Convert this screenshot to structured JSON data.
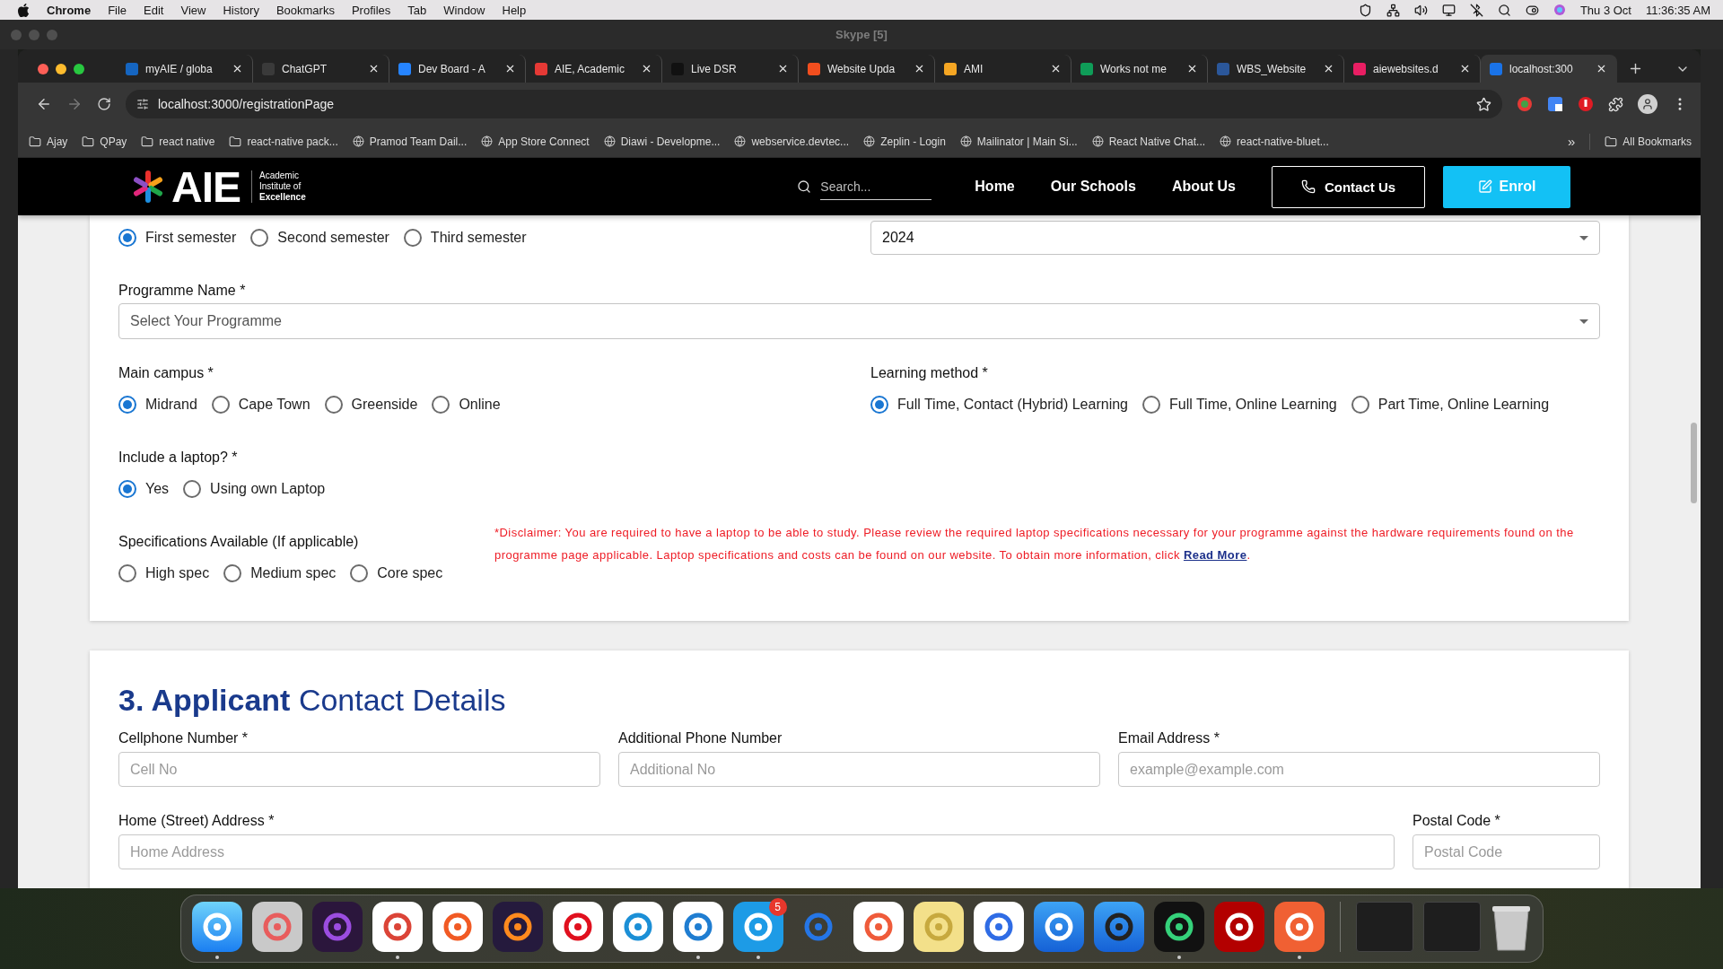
{
  "menu_bar": {
    "app": "Chrome",
    "items": [
      "File",
      "Edit",
      "View",
      "History",
      "Bookmarks",
      "Profiles",
      "Tab",
      "Window",
      "Help"
    ],
    "date": "Thu 3 Oct",
    "time": "11:36:35 AM"
  },
  "background_window": {
    "title": "Skype [5]"
  },
  "browser": {
    "tabs": [
      {
        "title": "myAIE / globa",
        "selected": false
      },
      {
        "title": "ChatGPT",
        "selected": false
      },
      {
        "title": "Dev Board - A",
        "selected": false
      },
      {
        "title": "AIE, Academic",
        "selected": false
      },
      {
        "title": "Live DSR",
        "selected": false
      },
      {
        "title": "Website Upda",
        "selected": false
      },
      {
        "title": "AMI",
        "selected": false
      },
      {
        "title": "Works not me",
        "selected": false
      },
      {
        "title": "WBS_Website",
        "selected": false
      },
      {
        "title": "aiewebsites.d",
        "selected": false
      },
      {
        "title": "localhost:300",
        "selected": true
      }
    ],
    "url": "localhost:3000/registrationPage",
    "bookmarks": [
      {
        "label": "Ajay",
        "kind": "folder"
      },
      {
        "label": "QPay",
        "kind": "folder"
      },
      {
        "label": "react native",
        "kind": "folder"
      },
      {
        "label": "react-native pack...",
        "kind": "folder"
      },
      {
        "label": "Pramod Team Dail...",
        "kind": "link"
      },
      {
        "label": "App Store Connect",
        "kind": "link"
      },
      {
        "label": "Diawi - Developme...",
        "kind": "link"
      },
      {
        "label": "webservice.devtec...",
        "kind": "link"
      },
      {
        "label": "Zeplin - Login",
        "kind": "link"
      },
      {
        "label": "Mailinator | Main Si...",
        "kind": "link"
      },
      {
        "label": "React Native Chat...",
        "kind": "link"
      },
      {
        "label": "react-native-bluet...",
        "kind": "link"
      }
    ],
    "more": "»",
    "all_bookmarks": "All Bookmarks"
  },
  "site": {
    "logo": {
      "name": "AIE",
      "tagline": [
        {
          "text": "Academic",
          "bold": false
        },
        {
          "text": "Institute of",
          "bold": false
        },
        {
          "text": "Excellence",
          "bold": true
        }
      ]
    },
    "search": {
      "placeholder": "Search..."
    },
    "nav": [
      "Home",
      "Our Schools",
      "About Us"
    ],
    "contact_button": "Contact Us",
    "enrol_button": "Enrol"
  },
  "form": {
    "semester": {
      "options": [
        {
          "label": "First semester",
          "selected": true
        },
        {
          "label": "Second semester",
          "selected": false
        },
        {
          "label": "Third semester",
          "selected": false
        }
      ]
    },
    "year": {
      "value": "2024"
    },
    "programme": {
      "label": "Programme Name *",
      "placeholder": "Select Your Programme"
    },
    "campus": {
      "label": "Main campus *",
      "options": [
        {
          "label": "Midrand",
          "selected": true
        },
        {
          "label": "Cape Town",
          "selected": false
        },
        {
          "label": "Greenside",
          "selected": false
        },
        {
          "label": "Online",
          "selected": false
        }
      ]
    },
    "learning_method": {
      "label": "Learning method *",
      "options": [
        {
          "label": "Full Time, Contact (Hybrid) Learning",
          "selected": true
        },
        {
          "label": "Full Time, Online Learning",
          "selected": false
        },
        {
          "label": "Part Time, Online Learning",
          "selected": false
        }
      ]
    },
    "laptop": {
      "label": "Include a laptop? *",
      "options": [
        {
          "label": "Yes",
          "selected": true
        },
        {
          "label": "Using own Laptop",
          "selected": false
        }
      ]
    },
    "specifications": {
      "label": "Specifications Available (If applicable)",
      "options": [
        {
          "label": "High spec",
          "selected": false
        },
        {
          "label": "Medium spec",
          "selected": false
        },
        {
          "label": "Core spec",
          "selected": false
        }
      ]
    },
    "disclaimer": {
      "text": "*Disclaimer: You are required to have a laptop to be able to study. Please review the required laptop specifications necessary for your programme against the hardware requirements found on the programme page applicable. Laptop specifications and costs can be found on our website. To obtain more information, click ",
      "link": "Read More",
      "suffix": "."
    }
  },
  "contact": {
    "heading": "**3. Applicant** Contact Details",
    "rows": [
      [
        {
          "label": "Cellphone Number *",
          "placeholder": "Cell No"
        },
        {
          "label": "Additional Phone Number",
          "placeholder": "Additional No"
        },
        {
          "label": "Email Address *",
          "placeholder": "example@example.com"
        }
      ],
      [
        {
          "label": "Home (Street) Address *",
          "placeholder": "Home Address"
        },
        {
          "label": "Postal Code *",
          "placeholder": "Postal Code"
        }
      ]
    ]
  },
  "dock": {
    "apps": [
      {
        "running": true
      },
      {
        "running": false
      },
      {
        "running": false
      },
      {
        "running": true
      },
      {
        "running": false
      },
      {
        "running": false
      },
      {
        "running": false
      },
      {
        "running": false
      },
      {
        "running": true
      },
      {
        "running": true,
        "badge": "5"
      },
      {
        "running": false
      },
      {
        "running": false
      },
      {
        "running": false
      },
      {
        "running": false
      },
      {
        "running": false
      },
      {
        "running": false
      },
      {
        "running": true
      },
      {
        "running": false
      },
      {
        "running": true
      }
    ]
  }
}
